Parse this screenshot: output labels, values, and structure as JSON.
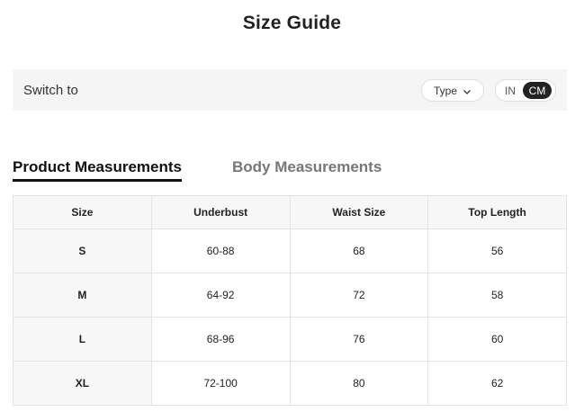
{
  "title": "Size Guide",
  "switch": {
    "label": "Switch to",
    "type_button": "Type",
    "units": {
      "in": "IN",
      "cm": "CM",
      "selected": "CM"
    }
  },
  "tabs": [
    {
      "label": "Product Measurements",
      "active": true
    },
    {
      "label": "Body Measurements",
      "active": false
    }
  ],
  "table": {
    "headers": [
      "Size",
      "Underbust",
      "Waist Size",
      "Top Length"
    ],
    "rows": [
      [
        "S",
        "60-88",
        "68",
        "56"
      ],
      [
        "M",
        "64-92",
        "72",
        "58"
      ],
      [
        "L",
        "68-96",
        "76",
        "60"
      ],
      [
        "XL",
        "72-100",
        "80",
        "62"
      ]
    ]
  }
}
